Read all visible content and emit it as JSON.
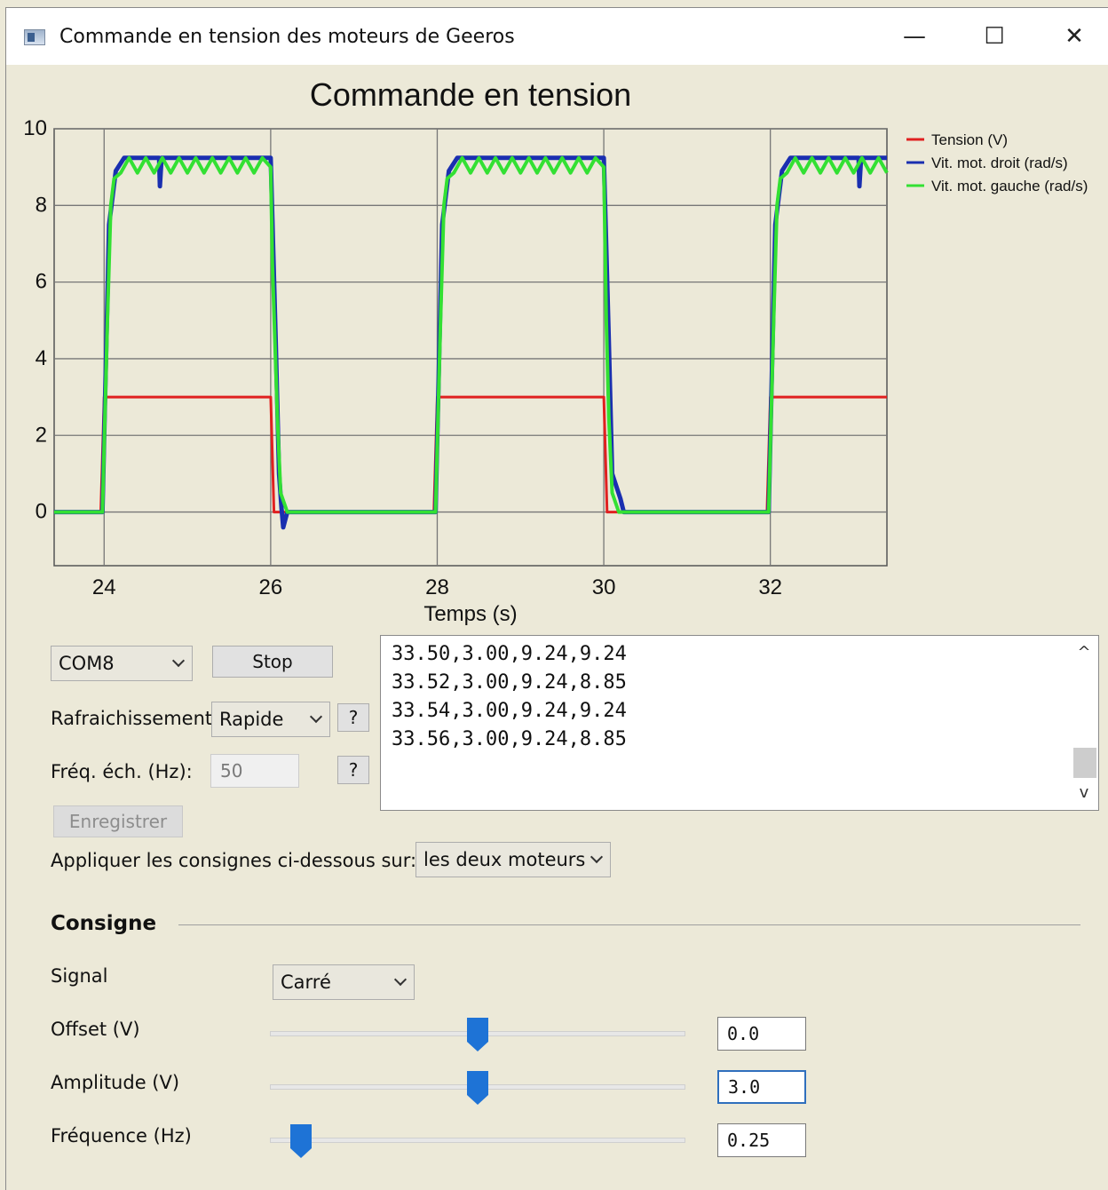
{
  "window": {
    "title": "Commande en tension des moteurs de Geeros",
    "minimize_symbol": "—",
    "maximize_symbol": "☐",
    "close_symbol": "✕"
  },
  "chart_data": {
    "type": "line",
    "title": "Commande en tension",
    "xlabel": "Temps (s)",
    "ylabel": "",
    "xlim": [
      23.4,
      33.4
    ],
    "ylim": [
      -1.4,
      10
    ],
    "x_ticks": [
      24,
      26,
      28,
      30,
      32
    ],
    "y_ticks": [
      0,
      2,
      4,
      6,
      8,
      10
    ],
    "grid": true,
    "legend_position": "right",
    "series": [
      {
        "name": "Tension (V)",
        "color": "#e02020",
        "points": [
          [
            23.4,
            0
          ],
          [
            23.96,
            0
          ],
          [
            24.0,
            3
          ],
          [
            26.0,
            3
          ],
          [
            26.04,
            0
          ],
          [
            27.96,
            0
          ],
          [
            28.0,
            3
          ],
          [
            30.0,
            3
          ],
          [
            30.04,
            0
          ],
          [
            31.96,
            0
          ],
          [
            32.0,
            3
          ],
          [
            33.4,
            3
          ]
        ]
      },
      {
        "name": "Vit. mot. droit (rad/s)",
        "color": "#1a2fb0",
        "points": [
          [
            23.4,
            0
          ],
          [
            23.98,
            0
          ],
          [
            24.06,
            7.5
          ],
          [
            24.14,
            8.9
          ],
          [
            24.24,
            9.24
          ],
          [
            24.66,
            9.24
          ],
          [
            24.67,
            8.5
          ],
          [
            24.69,
            9.24
          ],
          [
            26.0,
            9.24
          ],
          [
            26.06,
            4.5
          ],
          [
            26.1,
            1.0
          ],
          [
            26.13,
            0.1
          ],
          [
            26.15,
            -0.4
          ],
          [
            26.2,
            0
          ],
          [
            27.98,
            0
          ],
          [
            28.06,
            7.5
          ],
          [
            28.14,
            8.9
          ],
          [
            28.24,
            9.24
          ],
          [
            30.0,
            9.24
          ],
          [
            30.06,
            4.5
          ],
          [
            30.1,
            1.0
          ],
          [
            30.2,
            0.35
          ],
          [
            30.24,
            0
          ],
          [
            31.98,
            0
          ],
          [
            32.06,
            7.5
          ],
          [
            32.14,
            8.9
          ],
          [
            32.24,
            9.24
          ],
          [
            33.06,
            9.24
          ],
          [
            33.07,
            8.5
          ],
          [
            33.09,
            9.24
          ],
          [
            33.4,
            9.24
          ]
        ]
      },
      {
        "name": "Vit. mot. gauche (rad/s)",
        "color": "#33e033",
        "points": [
          [
            23.4,
            0
          ],
          [
            23.98,
            0
          ],
          [
            24.04,
            5
          ],
          [
            24.08,
            8
          ],
          [
            24.12,
            8.7
          ],
          [
            24.2,
            8.85
          ],
          [
            24.3,
            9.24
          ],
          [
            24.4,
            8.85
          ],
          [
            24.5,
            9.24
          ],
          [
            24.6,
            8.85
          ],
          [
            24.7,
            9.24
          ],
          [
            24.8,
            8.85
          ],
          [
            24.9,
            9.24
          ],
          [
            25.0,
            8.85
          ],
          [
            25.1,
            9.24
          ],
          [
            25.2,
            8.85
          ],
          [
            25.3,
            9.24
          ],
          [
            25.4,
            8.85
          ],
          [
            25.5,
            9.24
          ],
          [
            25.6,
            8.85
          ],
          [
            25.7,
            9.24
          ],
          [
            25.8,
            8.85
          ],
          [
            25.9,
            9.24
          ],
          [
            26.0,
            9.0
          ],
          [
            26.02,
            6.5
          ],
          [
            26.05,
            4.5
          ],
          [
            26.08,
            2.5
          ],
          [
            26.12,
            0.5
          ],
          [
            26.2,
            0
          ],
          [
            27.98,
            0
          ],
          [
            28.04,
            5
          ],
          [
            28.08,
            8
          ],
          [
            28.12,
            8.7
          ],
          [
            28.2,
            8.85
          ],
          [
            28.3,
            9.24
          ],
          [
            28.4,
            8.85
          ],
          [
            28.5,
            9.24
          ],
          [
            28.6,
            8.85
          ],
          [
            28.7,
            9.24
          ],
          [
            28.8,
            8.85
          ],
          [
            28.9,
            9.24
          ],
          [
            29.0,
            8.85
          ],
          [
            29.1,
            9.24
          ],
          [
            29.2,
            8.85
          ],
          [
            29.3,
            9.24
          ],
          [
            29.4,
            8.85
          ],
          [
            29.5,
            9.24
          ],
          [
            29.6,
            8.85
          ],
          [
            29.7,
            9.24
          ],
          [
            29.8,
            8.85
          ],
          [
            29.9,
            9.24
          ],
          [
            30.0,
            9.0
          ],
          [
            30.03,
            5
          ],
          [
            30.06,
            2.5
          ],
          [
            30.1,
            0.5
          ],
          [
            30.18,
            0
          ],
          [
            31.98,
            0
          ],
          [
            32.04,
            5
          ],
          [
            32.08,
            8
          ],
          [
            32.12,
            8.7
          ],
          [
            32.2,
            8.85
          ],
          [
            32.3,
            9.24
          ],
          [
            32.4,
            8.85
          ],
          [
            32.5,
            9.24
          ],
          [
            32.6,
            8.85
          ],
          [
            32.7,
            9.24
          ],
          [
            32.8,
            8.85
          ],
          [
            32.9,
            9.24
          ],
          [
            33.0,
            8.85
          ],
          [
            33.1,
            9.24
          ],
          [
            33.2,
            8.85
          ],
          [
            33.3,
            9.24
          ],
          [
            33.4,
            8.85
          ]
        ]
      }
    ]
  },
  "controls": {
    "port_select": "COM8",
    "stop_label": "Stop",
    "refresh_label": "Rafraichissement:",
    "refresh_select": "Rapide",
    "help_label": "?",
    "freq_label": "Fréq. éch. (Hz):",
    "freq_value": "50",
    "record_label": "Enregistrer",
    "apply_label": "Appliquer les consignes ci-dessous sur:",
    "apply_select": "les deux moteurs"
  },
  "log": {
    "lines": [
      "33.50,3.00,9.24,9.24",
      "33.52,3.00,9.24,8.85",
      "33.54,3.00,9.24,9.24",
      "33.56,3.00,9.24,8.85"
    ],
    "scroll_up": "^",
    "scroll_down": "v"
  },
  "consigne": {
    "title": "Consigne",
    "signal_label": "Signal",
    "signal_select": "Carré",
    "offset_label": "Offset (V)",
    "offset_value": "0.0",
    "offset_slider_fraction": 0.5,
    "amplitude_label": "Amplitude (V)",
    "amplitude_value": "3.0",
    "amplitude_slider_fraction": 0.5,
    "frequency_label": "Fréquence (Hz)",
    "frequency_value": "0.25",
    "frequency_slider_fraction": 0.05,
    "slider_color": "#1e73d6"
  }
}
